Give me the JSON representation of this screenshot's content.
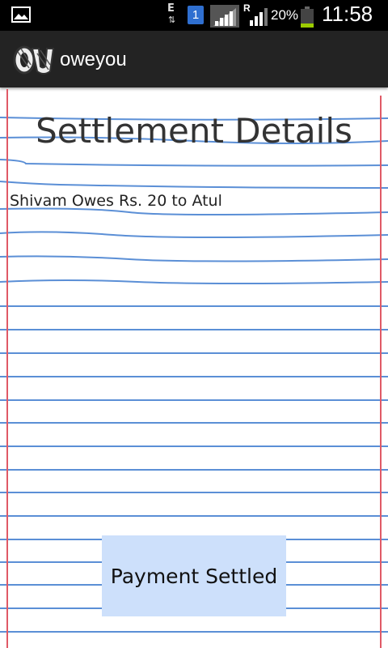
{
  "status_bar": {
    "network_type": "E",
    "network_arrows": "⇅",
    "sim_slot": "1",
    "roaming": "R",
    "battery_percent": "20%",
    "time": "11:58"
  },
  "action_bar": {
    "logo_text": "OU",
    "app_name": "oweyou"
  },
  "main": {
    "title": "Settlement Details",
    "settlement_text": "Shivam Owes Rs. 20 to Atul",
    "settle_button_label": "Payment Settled"
  },
  "colors": {
    "status_bar_bg": "#000000",
    "action_bar_bg": "#232323",
    "ruled_line": "#5b8fd6",
    "margin_line": "#e05a66",
    "button_bg": "#cde0fb"
  },
  "icons": [
    "gallery-icon",
    "sim-icon",
    "signal-icon",
    "battery-icon",
    "app-logo-icon"
  ]
}
